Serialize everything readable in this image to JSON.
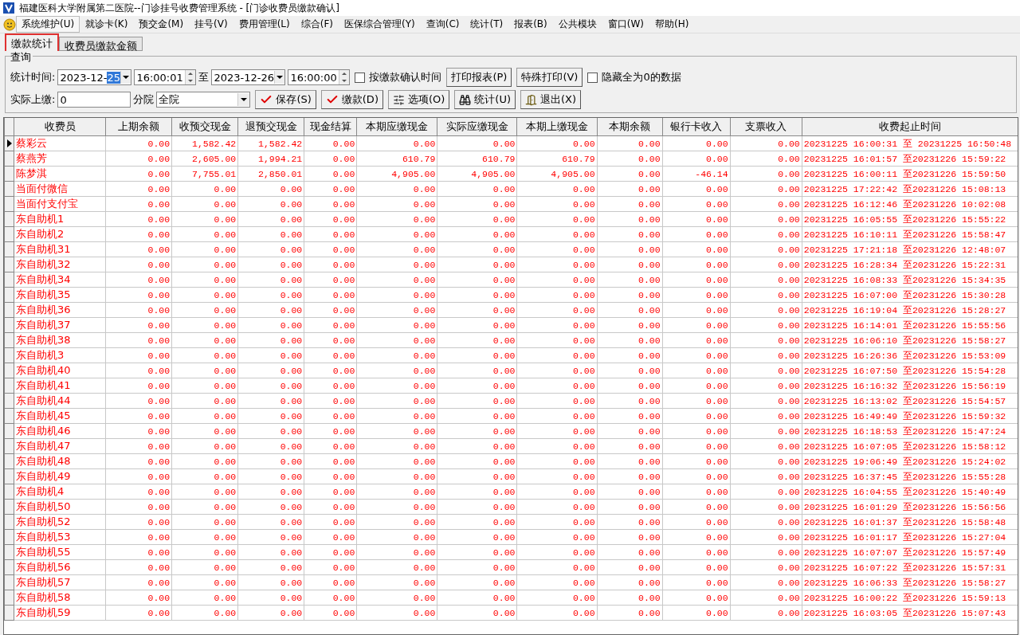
{
  "window": {
    "title": "福建医科大学附属第二医院--门诊挂号收费管理系统 - [门诊收费员缴款确认]"
  },
  "menu": [
    {
      "label": "系统维护(U)",
      "selected": true
    },
    {
      "label": "就诊卡(K)",
      "selected": false
    },
    {
      "label": "预交金(M)",
      "selected": false
    },
    {
      "label": "挂号(V)",
      "selected": false
    },
    {
      "label": "费用管理(L)",
      "selected": false
    },
    {
      "label": "综合(F)",
      "selected": false
    },
    {
      "label": "医保综合管理(Y)",
      "selected": false
    },
    {
      "label": "查询(C)",
      "selected": false
    },
    {
      "label": "统计(T)",
      "selected": false
    },
    {
      "label": "报表(B)",
      "selected": false
    },
    {
      "label": "公共模块",
      "selected": false
    },
    {
      "label": "窗口(W)",
      "selected": false
    },
    {
      "label": "帮助(H)",
      "selected": false
    }
  ],
  "tabs": [
    {
      "label": "缴款统计",
      "selected": true,
      "highlighted": true
    },
    {
      "label": "收费员缴款金额",
      "selected": false,
      "highlighted": false
    }
  ],
  "query": {
    "group_title": "查询",
    "time_label": "统计时间:",
    "date_from": {
      "unselected_text": "2023-12-",
      "selected_text": "25"
    },
    "time_from": "16:00:01",
    "to_label": "至",
    "date_to": "2023-12-26",
    "time_to": "16:00:00",
    "by_confirm_time": {
      "label": "按缴款确认时间",
      "checked": false
    },
    "print_report": "打印报表(P)",
    "special_print": "特殊打印(V)",
    "hide_zero": {
      "label": "隐藏全为0的数据",
      "checked": false
    },
    "actual_label": "实际上缴:",
    "actual_value": "0",
    "branch_label": "分院",
    "branch_value": "全院",
    "buttons": [
      {
        "kind": "check",
        "label": "保存(S)"
      },
      {
        "kind": "check",
        "label": "缴款(D)"
      },
      {
        "kind": "options",
        "label": "选项(O)"
      },
      {
        "kind": "binoculars",
        "label": "统计(U)"
      },
      {
        "kind": "exit",
        "label": "退出(X)"
      }
    ]
  },
  "table": {
    "columns": [
      "收费员",
      "上期余额",
      "收预交现金",
      "退预交现金",
      "现金结算",
      "本期应缴现金",
      "实际应缴现金",
      "本期上缴现金",
      "本期余额",
      "银行卡收入",
      "支票收入",
      "收费起止时间"
    ],
    "rows": [
      {
        "selected": true,
        "cells": [
          "蔡彩云",
          "0.00",
          "1,582.42",
          "1,582.42",
          "0.00",
          "0.00",
          "0.00",
          "0.00",
          "0.00",
          "0.00",
          "0.00",
          "20231225 16:00:31 至 20231225 16:50:48"
        ]
      },
      {
        "selected": false,
        "cells": [
          "蔡燕芳",
          "0.00",
          "2,605.00",
          "1,994.21",
          "0.00",
          "610.79",
          "610.79",
          "610.79",
          "0.00",
          "0.00",
          "0.00",
          "20231225 16:01:57 至20231226 15:59:22"
        ]
      },
      {
        "selected": false,
        "cells": [
          "陈梦淇",
          "0.00",
          "7,755.01",
          "2,850.01",
          "0.00",
          "4,905.00",
          "4,905.00",
          "4,905.00",
          "0.00",
          "-46.14",
          "0.00",
          "20231225 16:00:11 至20231226 15:59:50"
        ]
      },
      {
        "selected": false,
        "cells": [
          "当面付微信",
          "0.00",
          "0.00",
          "0.00",
          "0.00",
          "0.00",
          "0.00",
          "0.00",
          "0.00",
          "0.00",
          "0.00",
          "20231225 17:22:42 至20231226 15:08:13"
        ]
      },
      {
        "selected": false,
        "cells": [
          "当面付支付宝",
          "0.00",
          "0.00",
          "0.00",
          "0.00",
          "0.00",
          "0.00",
          "0.00",
          "0.00",
          "0.00",
          "0.00",
          "20231225 16:12:46 至20231226 10:02:08"
        ]
      },
      {
        "selected": false,
        "cells": [
          "东自助机1",
          "0.00",
          "0.00",
          "0.00",
          "0.00",
          "0.00",
          "0.00",
          "0.00",
          "0.00",
          "0.00",
          "0.00",
          "20231225 16:05:55 至20231226 15:55:22"
        ]
      },
      {
        "selected": false,
        "cells": [
          "东自助机2",
          "0.00",
          "0.00",
          "0.00",
          "0.00",
          "0.00",
          "0.00",
          "0.00",
          "0.00",
          "0.00",
          "0.00",
          "20231225 16:10:11 至20231226 15:58:47"
        ]
      },
      {
        "selected": false,
        "cells": [
          "东自助机31",
          "0.00",
          "0.00",
          "0.00",
          "0.00",
          "0.00",
          "0.00",
          "0.00",
          "0.00",
          "0.00",
          "0.00",
          "20231225 17:21:18 至20231226 12:48:07"
        ]
      },
      {
        "selected": false,
        "cells": [
          "东自助机32",
          "0.00",
          "0.00",
          "0.00",
          "0.00",
          "0.00",
          "0.00",
          "0.00",
          "0.00",
          "0.00",
          "0.00",
          "20231225 16:28:34 至20231226 15:22:31"
        ]
      },
      {
        "selected": false,
        "cells": [
          "东自助机34",
          "0.00",
          "0.00",
          "0.00",
          "0.00",
          "0.00",
          "0.00",
          "0.00",
          "0.00",
          "0.00",
          "0.00",
          "20231225 16:08:33 至20231226 15:34:35"
        ]
      },
      {
        "selected": false,
        "cells": [
          "东自助机35",
          "0.00",
          "0.00",
          "0.00",
          "0.00",
          "0.00",
          "0.00",
          "0.00",
          "0.00",
          "0.00",
          "0.00",
          "20231225 16:07:00 至20231226 15:30:28"
        ]
      },
      {
        "selected": false,
        "cells": [
          "东自助机36",
          "0.00",
          "0.00",
          "0.00",
          "0.00",
          "0.00",
          "0.00",
          "0.00",
          "0.00",
          "0.00",
          "0.00",
          "20231225 16:19:04 至20231226 15:28:27"
        ]
      },
      {
        "selected": false,
        "cells": [
          "东自助机37",
          "0.00",
          "0.00",
          "0.00",
          "0.00",
          "0.00",
          "0.00",
          "0.00",
          "0.00",
          "0.00",
          "0.00",
          "20231225 16:14:01 至20231226 15:55:56"
        ]
      },
      {
        "selected": false,
        "cells": [
          "东自助机38",
          "0.00",
          "0.00",
          "0.00",
          "0.00",
          "0.00",
          "0.00",
          "0.00",
          "0.00",
          "0.00",
          "0.00",
          "20231225 16:06:10 至20231226 15:58:27"
        ]
      },
      {
        "selected": false,
        "cells": [
          "东自助机3",
          "0.00",
          "0.00",
          "0.00",
          "0.00",
          "0.00",
          "0.00",
          "0.00",
          "0.00",
          "0.00",
          "0.00",
          "20231225 16:26:36 至20231226 15:53:09"
        ]
      },
      {
        "selected": false,
        "cells": [
          "东自助机40",
          "0.00",
          "0.00",
          "0.00",
          "0.00",
          "0.00",
          "0.00",
          "0.00",
          "0.00",
          "0.00",
          "0.00",
          "20231225 16:07:50 至20231226 15:54:28"
        ]
      },
      {
        "selected": false,
        "cells": [
          "东自助机41",
          "0.00",
          "0.00",
          "0.00",
          "0.00",
          "0.00",
          "0.00",
          "0.00",
          "0.00",
          "0.00",
          "0.00",
          "20231225 16:16:32 至20231226 15:56:19"
        ]
      },
      {
        "selected": false,
        "cells": [
          "东自助机44",
          "0.00",
          "0.00",
          "0.00",
          "0.00",
          "0.00",
          "0.00",
          "0.00",
          "0.00",
          "0.00",
          "0.00",
          "20231225 16:13:02 至20231226 15:54:57"
        ]
      },
      {
        "selected": false,
        "cells": [
          "东自助机45",
          "0.00",
          "0.00",
          "0.00",
          "0.00",
          "0.00",
          "0.00",
          "0.00",
          "0.00",
          "0.00",
          "0.00",
          "20231225 16:49:49 至20231226 15:59:32"
        ]
      },
      {
        "selected": false,
        "cells": [
          "东自助机46",
          "0.00",
          "0.00",
          "0.00",
          "0.00",
          "0.00",
          "0.00",
          "0.00",
          "0.00",
          "0.00",
          "0.00",
          "20231225 16:18:53 至20231226 15:47:24"
        ]
      },
      {
        "selected": false,
        "cells": [
          "东自助机47",
          "0.00",
          "0.00",
          "0.00",
          "0.00",
          "0.00",
          "0.00",
          "0.00",
          "0.00",
          "0.00",
          "0.00",
          "20231225 16:07:05 至20231226 15:58:12"
        ]
      },
      {
        "selected": false,
        "cells": [
          "东自助机48",
          "0.00",
          "0.00",
          "0.00",
          "0.00",
          "0.00",
          "0.00",
          "0.00",
          "0.00",
          "0.00",
          "0.00",
          "20231225 19:06:49 至20231226 15:24:02"
        ]
      },
      {
        "selected": false,
        "cells": [
          "东自助机49",
          "0.00",
          "0.00",
          "0.00",
          "0.00",
          "0.00",
          "0.00",
          "0.00",
          "0.00",
          "0.00",
          "0.00",
          "20231225 16:37:45 至20231226 15:55:28"
        ]
      },
      {
        "selected": false,
        "cells": [
          "东自助机4",
          "0.00",
          "0.00",
          "0.00",
          "0.00",
          "0.00",
          "0.00",
          "0.00",
          "0.00",
          "0.00",
          "0.00",
          "20231225 16:04:55 至20231226 15:40:49"
        ]
      },
      {
        "selected": false,
        "cells": [
          "东自助机50",
          "0.00",
          "0.00",
          "0.00",
          "0.00",
          "0.00",
          "0.00",
          "0.00",
          "0.00",
          "0.00",
          "0.00",
          "20231225 16:01:29 至20231226 15:56:56"
        ]
      },
      {
        "selected": false,
        "cells": [
          "东自助机52",
          "0.00",
          "0.00",
          "0.00",
          "0.00",
          "0.00",
          "0.00",
          "0.00",
          "0.00",
          "0.00",
          "0.00",
          "20231225 16:01:37 至20231226 15:58:48"
        ]
      },
      {
        "selected": false,
        "cells": [
          "东自助机53",
          "0.00",
          "0.00",
          "0.00",
          "0.00",
          "0.00",
          "0.00",
          "0.00",
          "0.00",
          "0.00",
          "0.00",
          "20231225 16:01:17 至20231226 15:27:04"
        ]
      },
      {
        "selected": false,
        "cells": [
          "东自助机55",
          "0.00",
          "0.00",
          "0.00",
          "0.00",
          "0.00",
          "0.00",
          "0.00",
          "0.00",
          "0.00",
          "0.00",
          "20231225 16:07:07 至20231226 15:57:49"
        ]
      },
      {
        "selected": false,
        "cells": [
          "东自助机56",
          "0.00",
          "0.00",
          "0.00",
          "0.00",
          "0.00",
          "0.00",
          "0.00",
          "0.00",
          "0.00",
          "0.00",
          "20231225 16:07:22 至20231226 15:57:31"
        ]
      },
      {
        "selected": false,
        "cells": [
          "东自助机57",
          "0.00",
          "0.00",
          "0.00",
          "0.00",
          "0.00",
          "0.00",
          "0.00",
          "0.00",
          "0.00",
          "0.00",
          "20231225 16:06:33 至20231226 15:58:27"
        ]
      },
      {
        "selected": false,
        "cells": [
          "东自助机58",
          "0.00",
          "0.00",
          "0.00",
          "0.00",
          "0.00",
          "0.00",
          "0.00",
          "0.00",
          "0.00",
          "0.00",
          "20231225 16:00:22 至20231226 15:59:13"
        ]
      },
      {
        "selected": false,
        "cells": [
          "东自助机59",
          "0.00",
          "0.00",
          "0.00",
          "0.00",
          "0.00",
          "0.00",
          "0.00",
          "0.00",
          "0.00",
          "0.00",
          "20231225 16:03:05 至20231226 15:07:43"
        ]
      }
    ]
  }
}
